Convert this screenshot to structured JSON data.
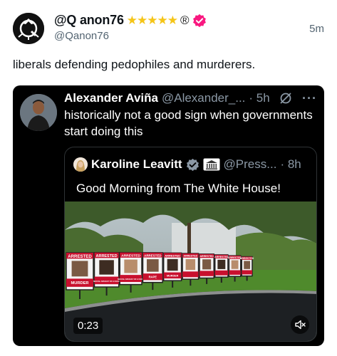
{
  "post": {
    "display_name": "@Q anon76",
    "stars": "★★★★★",
    "registered_mark": "®",
    "handle": "@Qanon76",
    "timestamp": "5m",
    "text": "liberals defending pedophiles and murderers."
  },
  "quoted_post": {
    "display_name": "Alexander Aviña",
    "handle": "@Alexander_...",
    "time": "· 5h",
    "more": "···",
    "text": "historically not a good sign when governments start doing this"
  },
  "nested_quote": {
    "display_name": "Karoline Leavitt",
    "handle": "@Press...",
    "time": "· 8h",
    "text": "Good Morning from The White House!",
    "video": {
      "duration": "0:23",
      "sign_headers": [
        "ARRESTED",
        "ARRESTED",
        "ARRESTED",
        "ARRESTED",
        "ARRESTED",
        "ARRESTED",
        "ARRESTED",
        "ARRESTED",
        "ARRESTED",
        "ARRESTED"
      ],
      "sign_crimes": [
        "MURDER",
        "SEXUAL ASSAULT OF A CHILD",
        "SEXUAL ASSAULT OF A CHILD",
        "RAPE",
        "MURDER",
        "",
        "",
        "",
        "",
        ""
      ]
    }
  },
  "colors": {
    "verified_pink": "#f91880",
    "verified_blue": "#1d9bf0",
    "sign_red": "#c8102e"
  }
}
